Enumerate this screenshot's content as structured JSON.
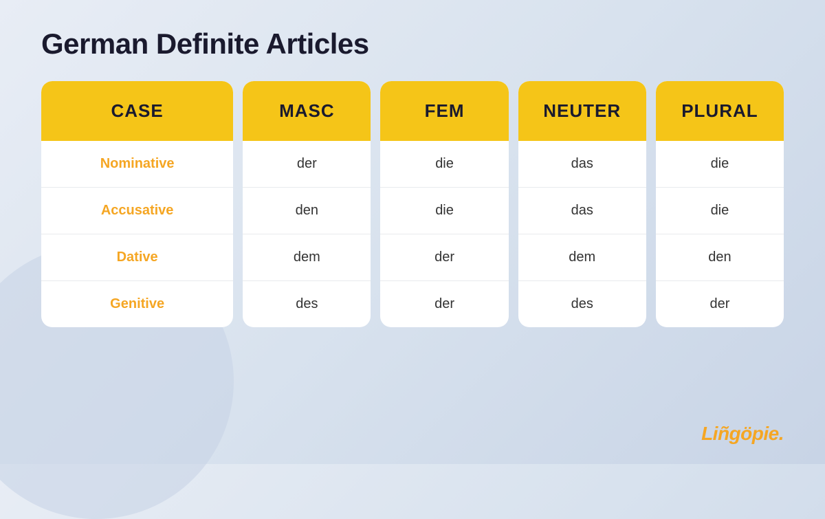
{
  "page": {
    "title": "German Definite Articles",
    "branding": "Liñgöpie."
  },
  "columns": [
    {
      "id": "case",
      "header": "CASE",
      "cells": [
        "Nominative",
        "Accusative",
        "Dative",
        "Genitive"
      ]
    },
    {
      "id": "masc",
      "header": "MASC",
      "cells": [
        "der",
        "den",
        "dem",
        "des"
      ]
    },
    {
      "id": "fem",
      "header": "FEM",
      "cells": [
        "die",
        "die",
        "der",
        "der"
      ]
    },
    {
      "id": "neuter",
      "header": "NEUTER",
      "cells": [
        "das",
        "das",
        "dem",
        "des"
      ]
    },
    {
      "id": "plural",
      "header": "PLURAL",
      "cells": [
        "die",
        "die",
        "den",
        "der"
      ]
    }
  ]
}
